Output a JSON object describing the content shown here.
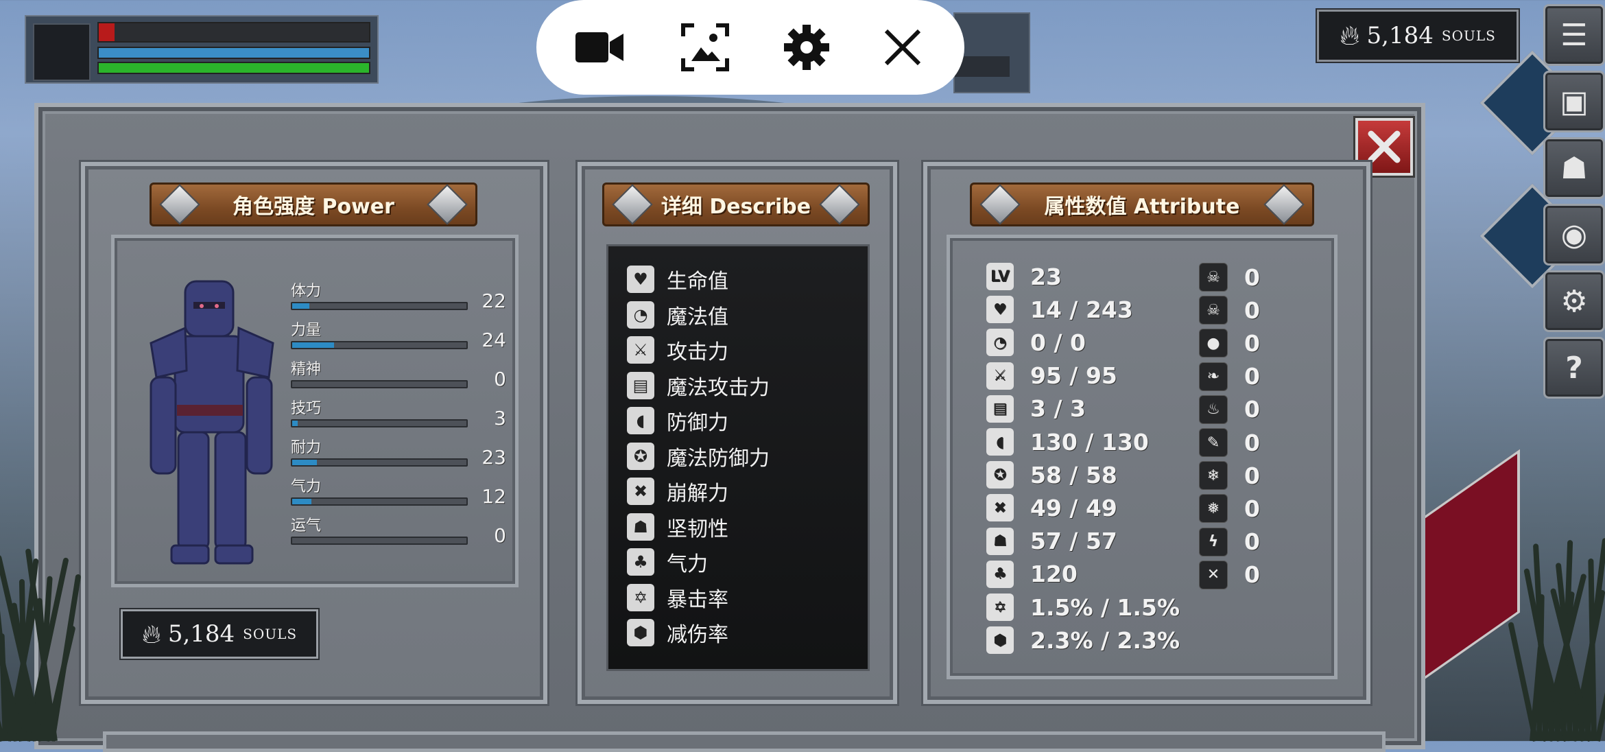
{
  "hud": {
    "hp_fraction": 0.058,
    "colors": {
      "hp": "#b81b1b",
      "mp": "#3b8ec6",
      "stamina": "#2bb52b"
    }
  },
  "record_toolbar": {
    "buttons": [
      {
        "name": "record-video-icon",
        "glyph": ""
      },
      {
        "name": "screenshot-icon",
        "glyph": ""
      },
      {
        "name": "settings-icon",
        "glyph": ""
      },
      {
        "name": "close-icon",
        "glyph": ""
      }
    ]
  },
  "souls": {
    "value": "5,184",
    "unit": "SOULS"
  },
  "panels": {
    "power": {
      "title": "角色强度 Power"
    },
    "describe": {
      "title": "详细 Describe"
    },
    "attribute": {
      "title": "属性数值 Attribute"
    }
  },
  "stats": [
    {
      "label": "体力",
      "value": "22",
      "fill": 0.1
    },
    {
      "label": "力量",
      "value": "24",
      "fill": 0.24
    },
    {
      "label": "精神",
      "value": "0",
      "fill": 0.0
    },
    {
      "label": "技巧",
      "value": "3",
      "fill": 0.03
    },
    {
      "label": "耐力",
      "value": "23",
      "fill": 0.14
    },
    {
      "label": "气力",
      "value": "12",
      "fill": 0.11
    },
    {
      "label": "运气",
      "value": "0",
      "fill": 0.0
    }
  ],
  "describe": [
    {
      "label": "生命值",
      "icon": "heart-icon"
    },
    {
      "label": "魔法值",
      "icon": "brain-icon"
    },
    {
      "label": "攻击力",
      "icon": "sword-icon"
    },
    {
      "label": "魔法攻击力",
      "icon": "spellbook-icon"
    },
    {
      "label": "防御力",
      "icon": "shield-icon"
    },
    {
      "label": "魔法防御力",
      "icon": "magic-shield-icon"
    },
    {
      "label": "崩解力",
      "icon": "break-axe-icon"
    },
    {
      "label": "坚韧性",
      "icon": "helmet-icon"
    },
    {
      "label": "气力",
      "icon": "lungs-icon"
    },
    {
      "label": "暴击率",
      "icon": "crit-star-icon"
    },
    {
      "label": "减伤率",
      "icon": "reduction-badge-icon"
    }
  ],
  "attributes_left": [
    {
      "icon": "level-icon",
      "glyph": "LV",
      "value": "23"
    },
    {
      "icon": "heart-icon",
      "glyph": "♥",
      "value": "14 / 243"
    },
    {
      "icon": "brain-icon",
      "glyph": "◔",
      "value": "0 / 0"
    },
    {
      "icon": "sword-icon",
      "glyph": "⚔",
      "value": "95 / 95"
    },
    {
      "icon": "spellbook-icon",
      "glyph": "▤",
      "value": "3 / 3"
    },
    {
      "icon": "shield-icon",
      "glyph": "◖",
      "value": "130 / 130"
    },
    {
      "icon": "magic-shield-icon",
      "glyph": "✪",
      "value": "58 / 58"
    },
    {
      "icon": "break-axe-icon",
      "glyph": "✖",
      "value": "49 / 49"
    },
    {
      "icon": "helmet-icon",
      "glyph": "☗",
      "value": "57 / 57"
    },
    {
      "icon": "lungs-icon",
      "glyph": "♣",
      "value": "120"
    },
    {
      "icon": "crit-star-icon",
      "glyph": "✡",
      "value": "1.5% / 1.5%"
    },
    {
      "icon": "reduction-badge-icon",
      "glyph": "⬢",
      "value": "2.3% / 2.3%"
    }
  ],
  "attributes_right": [
    {
      "icon": "poison-skull-icon",
      "glyph": "☠",
      "value": "0"
    },
    {
      "icon": "rot-skull-icon",
      "glyph": "☠",
      "value": "0"
    },
    {
      "icon": "bleed-drop-icon",
      "glyph": "●",
      "value": "0"
    },
    {
      "icon": "slash-drop-icon",
      "glyph": "❧",
      "value": "0"
    },
    {
      "icon": "fire-icon",
      "glyph": "♨",
      "value": "0"
    },
    {
      "icon": "burn-icon",
      "glyph": "✎",
      "value": "0"
    },
    {
      "icon": "frost-icon",
      "glyph": "❄",
      "value": "0"
    },
    {
      "icon": "frostbite-icon",
      "glyph": "❅",
      "value": "0"
    },
    {
      "icon": "lightning-icon",
      "glyph": "ϟ",
      "value": "0"
    },
    {
      "icon": "shock-icon",
      "glyph": "✕",
      "value": "0"
    }
  ],
  "side_buttons": [
    {
      "name": "menu-list-icon",
      "glyph": "☰"
    },
    {
      "name": "inventory-icon",
      "glyph": "▣"
    },
    {
      "name": "helmet-equipment-icon",
      "glyph": "☗"
    },
    {
      "name": "skills-emblem-icon",
      "glyph": "◉"
    },
    {
      "name": "gear-settings-icon",
      "glyph": "⚙"
    },
    {
      "name": "help-icon",
      "glyph": "?"
    }
  ]
}
